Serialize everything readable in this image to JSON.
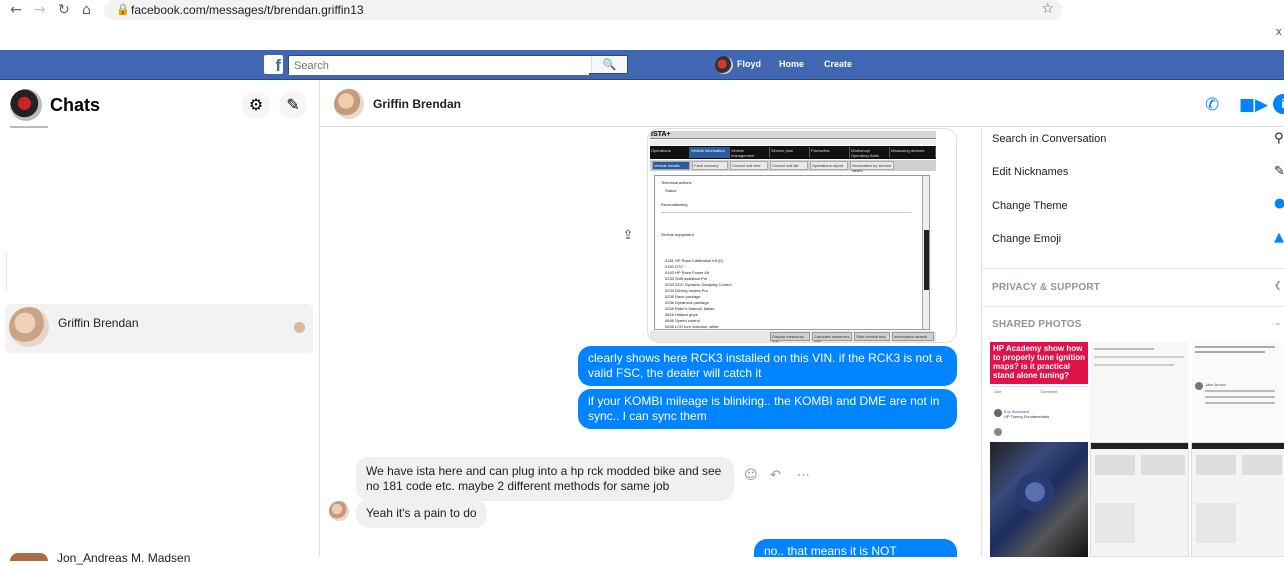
{
  "browser": {
    "url": "facebook.com/messages/t/brendan.griffin13",
    "close_mark": "x"
  },
  "topbar": {
    "search_placeholder": "Search",
    "user_name": "Floyd",
    "home_label": "Home",
    "create_label": "Create",
    "brand_color": "#4267b2"
  },
  "sidebar": {
    "title": "Chats",
    "conversations": [
      {
        "name": "Griffin Brendan"
      }
    ],
    "partial_conversation": "Jon_Andreas M. Madsen"
  },
  "chat": {
    "header_name": "Griffin Brendan",
    "accent": "#0084ff",
    "messages": [
      {
        "dir": "out",
        "text": "clearly shows here RCK3 installed on this VIN. if the RCK3 is not a valid FSC, the dealer will catch it"
      },
      {
        "dir": "out",
        "text": "if your KOMBI mileage is blinking.. the KOMBI and DME are not in sync.. I can sync them"
      },
      {
        "dir": "in",
        "text": "We have ista here and can plug into a hp rck modded bike and see no 181 code etc. maybe 2 different methods for same job"
      },
      {
        "dir": "in",
        "text": "Yeah it's a pain to do"
      },
      {
        "dir": "out",
        "text": "no.. that means it is NOT ACTIVATED"
      }
    ],
    "image": {
      "app_title": "ISTA+",
      "tabs": [
        "Operations",
        "Vehicle information",
        "Vehicle management",
        "Service plan",
        "Favourites",
        "Workshop/ Operating fluids",
        "Measuring devices"
      ],
      "subtabs": [
        "Vehicle details",
        "Fault memory",
        "Control unit tree",
        "Control unit list",
        "Operations report",
        "Information by service cases"
      ],
      "rows": [
        "Technical actions",
        "Status",
        "Reconditioning",
        "Vehicle equipment",
        "0181   HP Race Calibration Kit (K)",
        "0182   DTC",
        "0183   HP Race Power Kit",
        "0233   Shift assistant Pro",
        "0233   DDC Dynamic Damping Control",
        "0234   Driving modes Pro",
        "0235   Race package",
        "0236   Dynamics package",
        "0245   Rider's Manual, Italian",
        "0616   Heated grips",
        "0646   Speed control",
        "0636   LCD turn indicator, white"
      ],
      "footer_buttons": [
        "Display measures plan",
        "Calculate measures plan",
        "Start vehicle test",
        "Information search"
      ]
    }
  },
  "details": {
    "actions": [
      {
        "label": "Search in Conversation",
        "icon": "search-icon"
      },
      {
        "label": "Edit Nicknames",
        "icon": "pencil-icon"
      },
      {
        "label": "Change Theme",
        "icon": "theme-icon"
      },
      {
        "label": "Change Emoji",
        "icon": "thumbs-up-icon"
      }
    ],
    "privacy_heading": "PRIVACY & SUPPORT",
    "photos_heading": "SHARED PHOTOS",
    "photo_caption": "HP Academy show how to properly tune ignition maps? is it practical stand alone tuning?",
    "photo_post_1_author": "Eric Bouchard",
    "photo_post_1_text": "HP Tuning Fundamentals",
    "photo_post_2_author": "Jake Brown",
    "photo_like_label": "Like",
    "photo_comment_label": "Comment"
  }
}
